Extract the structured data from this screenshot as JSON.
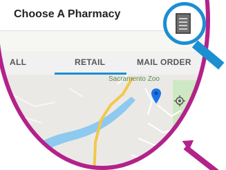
{
  "appbar": {
    "title": "Choose A Pharmacy"
  },
  "tabs": [
    {
      "label": "ALL"
    },
    {
      "label": "RETAIL",
      "active": true
    },
    {
      "label": "MAIL ORDER"
    }
  ],
  "map": {
    "place_label": "Sacramento Zoo",
    "marker_icon": "location-pin-icon"
  },
  "menu_button": {
    "icon": "hamburger-menu-icon"
  },
  "colors": {
    "lens_ring": "#b3228a",
    "magnifier": "#1b8fd1",
    "accent": "#1b8fd1",
    "river": "#8ec9ef",
    "road": "#f2c84b"
  }
}
